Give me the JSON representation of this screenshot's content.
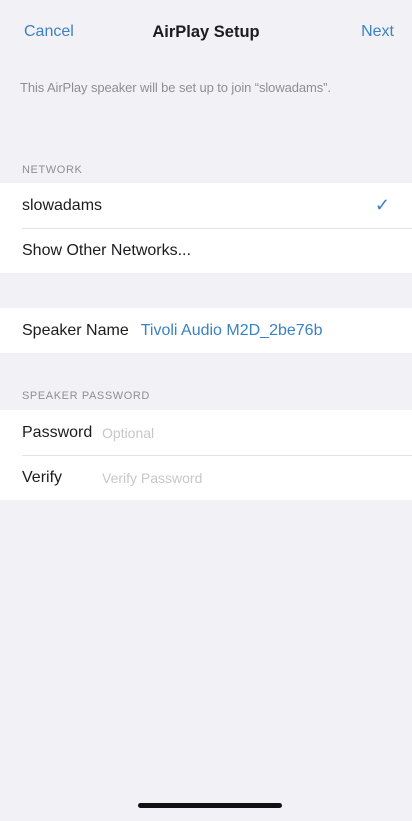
{
  "navbar": {
    "cancel_label": "Cancel",
    "title": "AirPlay Setup",
    "next_label": "Next"
  },
  "info_text": "This AirPlay speaker will be set up to join “slowadams”.",
  "network": {
    "header": "NETWORK",
    "selected_network": "slowadams",
    "checkmark": "✓",
    "other_networks_label": "Show Other Networks..."
  },
  "speaker": {
    "name_label": "Speaker Name",
    "name_value": "Tivoli Audio M2D_2be76b"
  },
  "password_section": {
    "header": "SPEAKER PASSWORD",
    "password_label": "Password",
    "password_placeholder": "Optional",
    "verify_label": "Verify",
    "verify_placeholder": "Verify Password"
  },
  "colors": {
    "accent": "#3b82c4",
    "background": "#f2f2f6",
    "secondary_text": "#8e8e93"
  }
}
